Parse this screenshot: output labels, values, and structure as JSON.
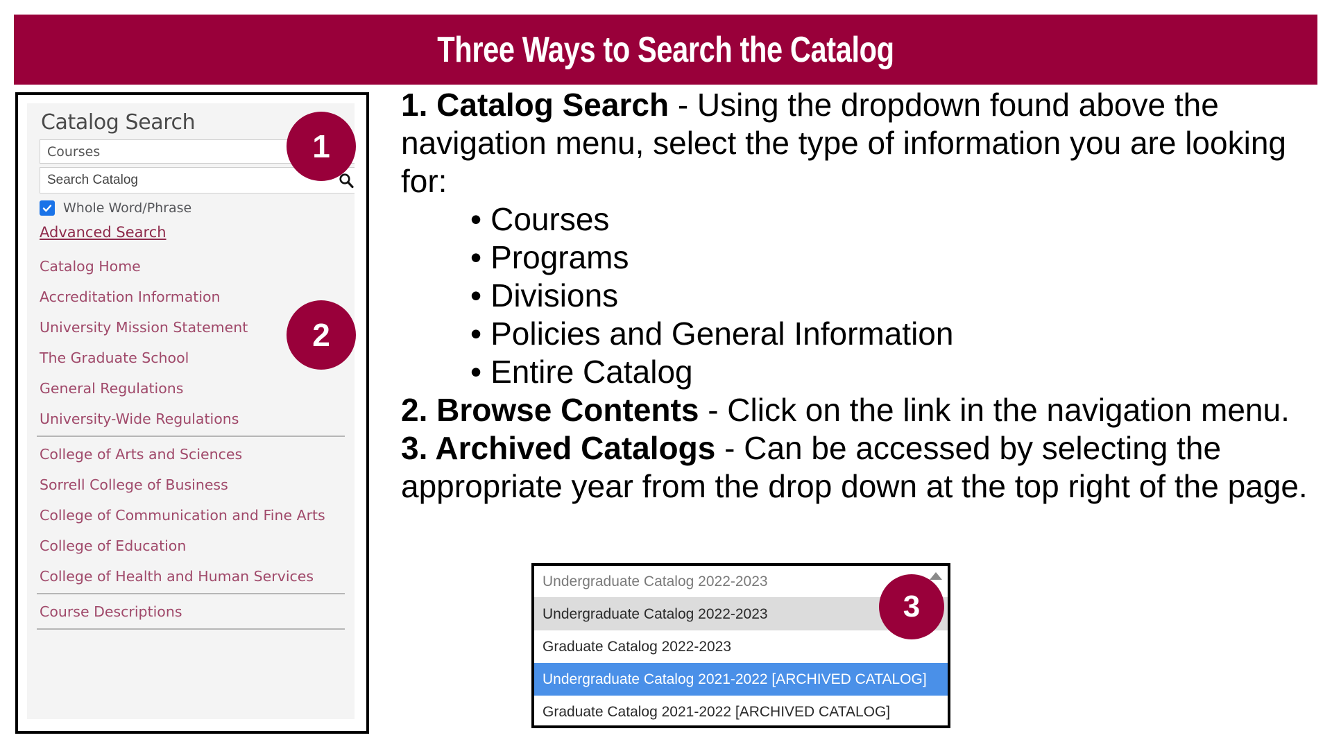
{
  "header": {
    "title": "Three Ways to Search the Catalog",
    "background_color": "#99003a",
    "text_color": "#ffffff"
  },
  "sidebar": {
    "heading": "Catalog Search",
    "type_select": {
      "value": "Courses",
      "options": [
        "Courses",
        "Programs",
        "Divisions",
        "Policies and General Information",
        "Entire Catalog"
      ]
    },
    "search_input": {
      "placeholder": "Search Catalog",
      "value": "Search Catalog",
      "icon": "search-icon"
    },
    "whole_word": {
      "label": "Whole Word/Phrase",
      "checked": true,
      "check_color": "#1a73e8",
      "check_glyph": "✓"
    },
    "advanced_search_label": "Advanced Search",
    "link_color": "#a0496a",
    "nav_items": [
      {
        "label": "Catalog Home",
        "divider_after": false
      },
      {
        "label": "Accreditation Information",
        "divider_after": false
      },
      {
        "label": "University Mission Statement",
        "divider_after": false
      },
      {
        "label": "The Graduate School",
        "divider_after": false
      },
      {
        "label": "General Regulations",
        "divider_after": false
      },
      {
        "label": "University-Wide Regulations",
        "divider_after": true
      },
      {
        "label": "College of Arts and Sciences",
        "divider_after": false
      },
      {
        "label": "Sorrell College of Business",
        "divider_after": false
      },
      {
        "label": "College of Communication and Fine Arts",
        "divider_after": false
      },
      {
        "label": "College of Education",
        "divider_after": false
      },
      {
        "label": "College of Health and Human Services",
        "divider_after": true
      },
      {
        "label": "Course Descriptions",
        "divider_after": true
      }
    ]
  },
  "main": {
    "item1": {
      "bold": "1. Catalog Search",
      "rest": " - Using the dropdown found above the navigation menu, select the type of information you are looking for:"
    },
    "bullets": [
      "Courses",
      "Programs",
      "Divisions",
      "Policies and General Information",
      "Entire Catalog"
    ],
    "bullet_glyph": "•",
    "item2": {
      "bold": "2. Browse Contents",
      "rest": " - Click on the link in the navigation menu."
    },
    "item3": {
      "bold": "3. Archived Catalogs",
      "rest": " - Can be accessed by selecting the appropriate year from the drop down at the top right of the page."
    }
  },
  "year_dropdown": {
    "header_value": "Undergraduate Catalog 2022-2023",
    "scroll_arrow": "scroll-up-arrow-icon",
    "options": [
      {
        "label": "Undergraduate Catalog 2022-2023",
        "state": "hover",
        "bg": "#dcdcdc"
      },
      {
        "label": "Graduate Catalog 2022-2023",
        "state": "normal",
        "bg": "#ffffff"
      },
      {
        "label": "Undergraduate Catalog 2021-2022 [ARCHIVED CATALOG]",
        "state": "selected",
        "bg": "#4a90e8"
      },
      {
        "label": "Graduate Catalog 2021-2022 [ARCHIVED CATALOG]",
        "state": "normal",
        "bg": "#ffffff"
      }
    ]
  },
  "badges": {
    "one": "1",
    "two": "2",
    "three": "3",
    "color": "#99003a"
  }
}
